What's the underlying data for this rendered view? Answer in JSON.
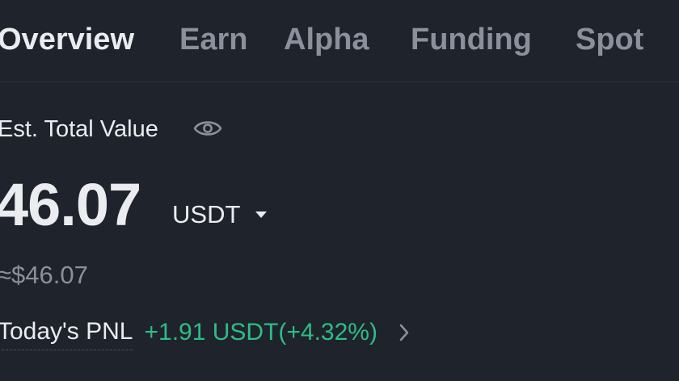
{
  "tabs": [
    {
      "label": "Overview",
      "active": true
    },
    {
      "label": "Earn",
      "active": false
    },
    {
      "label": "Alpha",
      "active": false
    },
    {
      "label": "Funding",
      "active": false
    },
    {
      "label": "Spot",
      "active": false
    }
  ],
  "summary": {
    "est_label": "Est. Total Value",
    "value": "46.07",
    "currency": "USDT",
    "approx": "≈$46.07",
    "pnl_label": "Today's PNL",
    "pnl_value": "+1.91 USDT(+4.32%)"
  },
  "icons": {
    "visibility": "eye-icon",
    "currency_dropdown": "caret-down-icon",
    "pnl_details": "chevron-right-icon"
  },
  "colors": {
    "background": "#1f232c",
    "primary_text": "#eaecef",
    "secondary_text": "#8b909a",
    "positive": "#2ebd85"
  }
}
